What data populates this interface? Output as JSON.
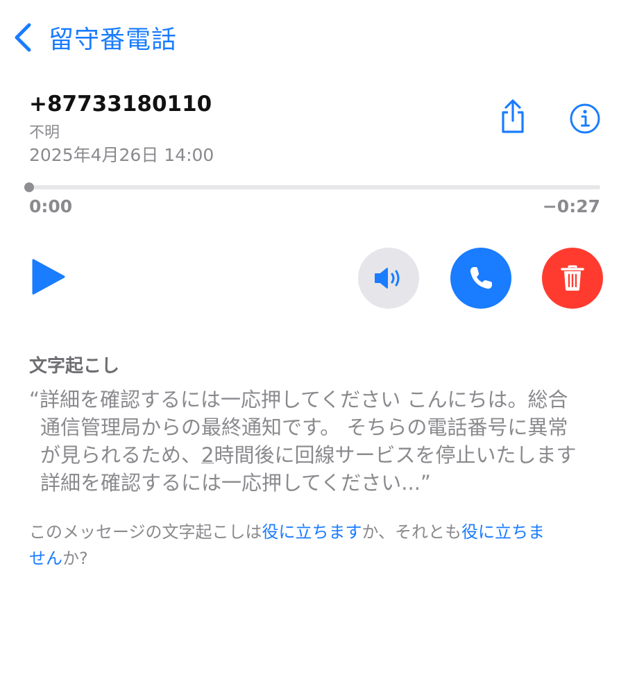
{
  "nav": {
    "back_label": "留守番電話"
  },
  "voicemail": {
    "number": "+87733180110",
    "label": "不明",
    "datetime": "2025年4月26日 14:00"
  },
  "playback": {
    "elapsed": "0:00",
    "remaining": "−0:27",
    "progress_fraction": 0
  },
  "controls": {
    "play_icon": "play-icon",
    "speaker_icon": "speaker-icon",
    "call_icon": "phone-icon",
    "delete_icon": "trash-icon",
    "share_icon": "share-icon",
    "info_icon": "info-icon"
  },
  "transcription": {
    "heading": "文字起こし",
    "line1": "“詳細を確認するには一応押してください こんにちは。総合",
    "line2": "通信管理局からの最終通知です。 そちらの電話番号に異常",
    "line3_a": "が見られるため、",
    "line3_underlined": "2",
    "line3_b": "時間後に回線サービスを停止いたします",
    "line4": "詳細を確認するには一応押してください...”"
  },
  "feedback": {
    "prefix": "このメッセージの文字起こしは",
    "useful_link": "役に立ちます",
    "middle": "か、それとも",
    "not_useful_link": "役に立ちません",
    "suffix": "か?"
  },
  "colors": {
    "accent": "#1a7cff",
    "delete": "#ff3b30",
    "speaker_bg": "#e5e5ea",
    "secondary_text": "#8a8a8e"
  }
}
